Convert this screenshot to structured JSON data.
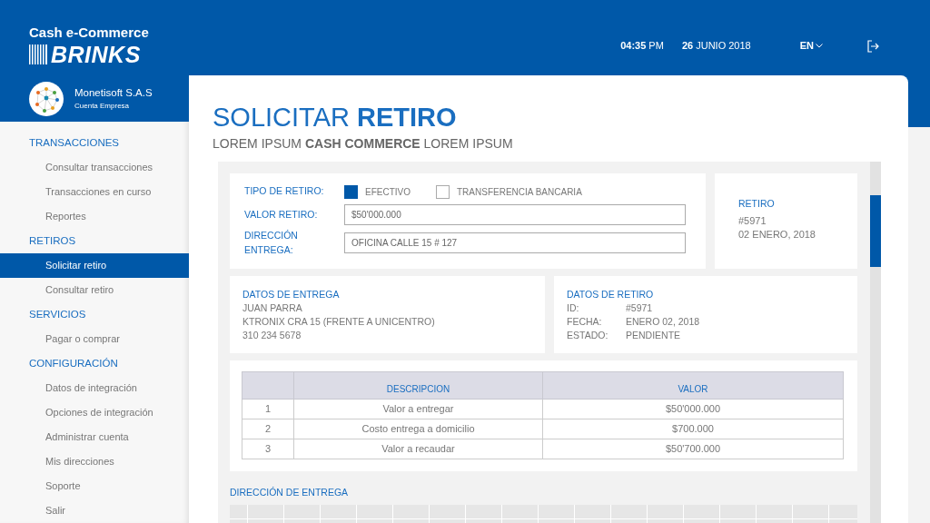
{
  "brand": {
    "tagline": "Cash e-Commerce",
    "name": "BRINKS"
  },
  "account": {
    "company": "Monetisoft S.A.S",
    "type": "Cuenta Empresa"
  },
  "topbar": {
    "time": "**04:35** PM",
    "date": "**26** JUNIO 2018",
    "language": "EN"
  },
  "sidebar": {
    "sections": [
      {
        "title": "TRANSACCIONES",
        "items": [
          {
            "label": "Consultar transacciones",
            "selected": false
          },
          {
            "label": "Transacciones en curso",
            "selected": false
          },
          {
            "label": "Reportes",
            "selected": false
          }
        ]
      },
      {
        "title": "RETIROS",
        "items": [
          {
            "label": "Solicitar retiro",
            "selected": true
          },
          {
            "label": "Consultar retiro",
            "selected": false
          }
        ]
      },
      {
        "title": "SERVICIOS",
        "items": [
          {
            "label": "Pagar o comprar",
            "selected": false
          }
        ]
      },
      {
        "title": "CONFIGURACIÓN",
        "items": [
          {
            "label": "Datos de integración",
            "selected": false
          },
          {
            "label": "Opciones de integración",
            "selected": false
          },
          {
            "label": "Administrar cuenta",
            "selected": false
          },
          {
            "label": "Mis direcciones",
            "selected": false
          },
          {
            "label": "Soporte",
            "selected": false
          },
          {
            "label": "Salir",
            "selected": false
          }
        ]
      }
    ]
  },
  "page": {
    "title": "SOLICITAR **RETIRO**",
    "subtitle": "LOREM IPSUM **CASH COMMERCE** LOREM IPSUM"
  },
  "form": {
    "type_label": "TIPO DE RETIRO:",
    "options": [
      {
        "label": "EFECTIVO",
        "selected": true
      },
      {
        "label": "TRANSFERENCIA BANCARIA",
        "selected": false
      }
    ],
    "fields": [
      {
        "label": "VALOR RETIRO:",
        "value": "$50'000.000"
      },
      {
        "label": "DIRECCIÓN ENTREGA:",
        "value": "OFICINA CALLE 15 # 127"
      }
    ]
  },
  "retiro_summary": {
    "title": "RETIRO",
    "lines": [
      "#5971",
      "02 ENERO, 2018"
    ]
  },
  "delivery": {
    "title": "DATOS DE ENTREGA",
    "lines": [
      "JUAN PARRA",
      "KTRONIX CRA 15 (FRENTE A UNICENTRO)",
      "310 234 5678"
    ]
  },
  "withdrawal": {
    "title": "DATOS DE RETIRO",
    "rows": [
      {
        "key": "ID:",
        "value": "#5971"
      },
      {
        "key": "FECHA:",
        "value": "ENERO 02, 2018"
      },
      {
        "key": "ESTADO:",
        "value": "PENDIENTE"
      }
    ]
  },
  "table": {
    "columns": [
      "DESCRIPCION",
      "VALOR"
    ],
    "rows": [
      {
        "number": "1",
        "description": "Valor a entregar",
        "value": "$50'000.000"
      },
      {
        "number": "2",
        "description": "Costo entrega a domicilio",
        "value": "$700.000"
      },
      {
        "number": "3",
        "description": "Valor a recaudar",
        "value": "$50'700.000"
      }
    ]
  },
  "map_section": {
    "title": "DIRECCIÓN DE ENTREGA"
  }
}
